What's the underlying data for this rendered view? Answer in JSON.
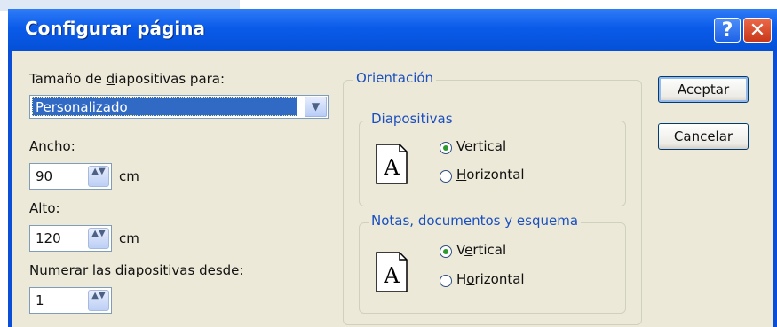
{
  "window": {
    "title": "Configurar página",
    "help_glyph": "?",
    "close_glyph": "✕"
  },
  "size": {
    "label_pre": "Tamaño de ",
    "label_accel": "d",
    "label_post": "iapositivas para:",
    "selected": "Personalizado",
    "dropdown_glyph": "▼"
  },
  "width": {
    "label_accel": "A",
    "label_post": "ncho:",
    "value": "90",
    "unit": "cm"
  },
  "height": {
    "label_pre": "Alt",
    "label_accel": "o",
    "label_post": ":",
    "value": "120",
    "unit": "cm"
  },
  "numbering": {
    "label_accel": "N",
    "label_post": "umerar las diapositivas desde:",
    "value": "1"
  },
  "orientation": {
    "title": "Orientación",
    "slides": {
      "title": "Diapositivas",
      "icon_letter": "A",
      "vertical": {
        "accel": "V",
        "rest": "ertical",
        "selected": true
      },
      "horizontal": {
        "accel": "H",
        "rest": "orizontal",
        "selected": false
      }
    },
    "notes": {
      "title": "Notas, documentos y esquema",
      "icon_letter": "A",
      "vertical_pre": "V",
      "vertical_accel": "e",
      "vertical_post": "rtical",
      "horizontal_pre": "H",
      "horizontal_accel": "o",
      "horizontal_post": "rizontal",
      "vertical_selected": true
    }
  },
  "buttons": {
    "accept": "Aceptar",
    "cancel": "Cancelar"
  },
  "spin_glyph": "▲▼"
}
